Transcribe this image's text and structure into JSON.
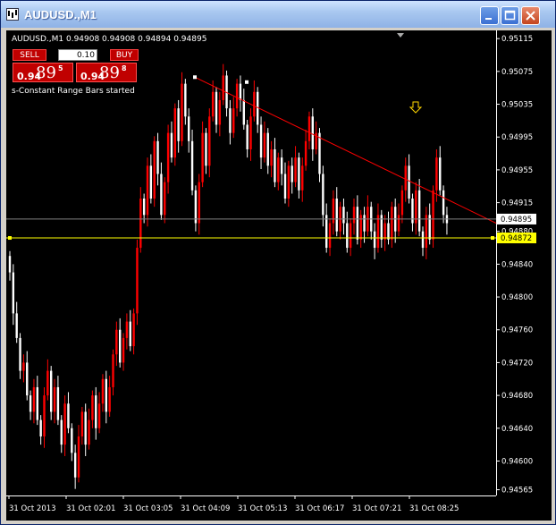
{
  "window": {
    "title": "AUDUSD.,M1"
  },
  "panel": {
    "symbol_line": "AUDUSD.,M1  0.94908 0.94908 0.94894 0.94895",
    "sell_label": "SELL",
    "buy_label": "BUY",
    "lot_value": "0.10",
    "sell_price": {
      "main": "0.94",
      "big": "89",
      "sup": "5"
    },
    "buy_price": {
      "main": "0.94",
      "big": "89",
      "sup": "8"
    },
    "status": "s-Constant Range Bars started"
  },
  "colors": {
    "background": "#000000",
    "candle_up": "#ff0000",
    "candle_down": "#ffffff",
    "trendline": "#ff0000",
    "bid_line": "#808080",
    "level_line": "#ffff00",
    "arrow": "#ffd700"
  },
  "icons": {
    "app": "chart-window-icon",
    "minimize": "minimize-icon",
    "maximize": "maximize-icon",
    "close": "close-icon",
    "arrow": "down-arrow-icon"
  },
  "chart_data": {
    "type": "candlestick",
    "title": "AUDUSD.,M1",
    "ylim": [
      0.94558,
      0.95125
    ],
    "y_ticks": [
      "0.95115",
      "0.95075",
      "0.95035",
      "0.94995",
      "0.94955",
      "0.94915",
      "0.94880",
      "0.94840",
      "0.94800",
      "0.94760",
      "0.94720",
      "0.94680",
      "0.94640",
      "0.94600",
      "0.94565"
    ],
    "x_ticks": [
      "31 Oct 2013",
      "31 Oct 02:01",
      "31 Oct 03:05",
      "31 Oct 04:09",
      "31 Oct 05:13",
      "31 Oct 06:17",
      "31 Oct 07:21",
      "31 Oct 08:25"
    ],
    "current_price": "0.94895",
    "level_price": "0.94872",
    "trendline": {
      "from": {
        "x": "31 Oct 04:09",
        "y": 0.95068
      },
      "to": {
        "x": "31 Oct 08:25",
        "y": 0.9489
      }
    },
    "closes": [
      0.9483,
      0.9478,
      0.9475,
      0.9471,
      0.9472,
      0.9468,
      0.9466,
      0.9469,
      0.9465,
      0.9463,
      0.9468,
      0.9471,
      0.9466,
      0.9469,
      0.9465,
      0.9462,
      0.9467,
      0.9464,
      0.9461,
      0.9458,
      0.9463,
      0.9466,
      0.9462,
      0.9465,
      0.9468,
      0.9464,
      0.9467,
      0.947,
      0.9466,
      0.9469,
      0.9473,
      0.9476,
      0.9472,
      0.9475,
      0.9477,
      0.9474,
      0.9478,
      0.9486,
      0.9492,
      0.949,
      0.9496,
      0.9492,
      0.9499,
      0.9495,
      0.949,
      0.9494,
      0.95,
      0.9497,
      0.9503,
      0.9499,
      0.9506,
      0.9502,
      0.9499,
      0.9493,
      0.9489,
      0.9494,
      0.95,
      0.9496,
      0.9502,
      0.9505,
      0.9501,
      0.9504,
      0.9507,
      0.9503,
      0.95,
      0.9503,
      0.9506,
      0.9504,
      0.9501,
      0.9498,
      0.9502,
      0.9505,
      0.9501,
      0.9497,
      0.95,
      0.9496,
      0.9498,
      0.9494,
      0.9497,
      0.9495,
      0.9492,
      0.9496,
      0.9494,
      0.9497,
      0.9493,
      0.9496,
      0.9499,
      0.9502,
      0.9498,
      0.95,
      0.9495,
      0.949,
      0.9486,
      0.9489,
      0.9492,
      0.9488,
      0.9491,
      0.9489,
      0.9486,
      0.9489,
      0.9491,
      0.9487,
      0.949,
      0.9488,
      0.9491,
      0.9488,
      0.9486,
      0.949,
      0.9487,
      0.9489,
      0.9487,
      0.9491,
      0.9488,
      0.949,
      0.9493,
      0.9496,
      0.9492,
      0.9489,
      0.9493,
      0.9488,
      0.9486,
      0.949,
      0.9487,
      0.9493,
      0.9497,
      0.9493,
      0.949,
      0.9489
    ]
  }
}
